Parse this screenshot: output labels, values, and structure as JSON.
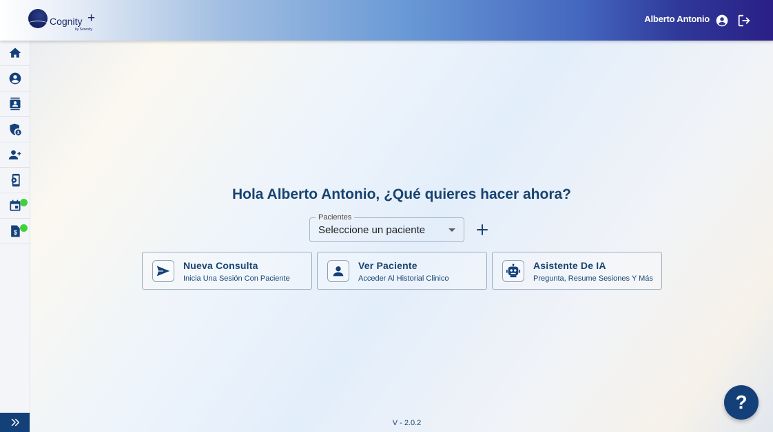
{
  "app": {
    "logo_text": "Cognity",
    "logo_plus": "+",
    "logo_sub": "by Serenity"
  },
  "header": {
    "user_name": "Alberto Antonio",
    "user_icon": "account-circle-icon",
    "logout_icon": "logout-icon"
  },
  "sidebar": {
    "items": [
      {
        "icon": "home-icon"
      },
      {
        "icon": "account-circle-icon"
      },
      {
        "icon": "contacts-icon"
      },
      {
        "icon": "shield-user-icon"
      },
      {
        "icon": "person-add-icon"
      },
      {
        "icon": "phone-settings-icon"
      },
      {
        "icon": "calendar-icon",
        "badge_color": "#3fd13c"
      },
      {
        "icon": "invoice-dollar-icon",
        "badge_color": "#3fd13c"
      }
    ],
    "expand_icon": "double-chevron-right-icon"
  },
  "main": {
    "greeting": "Hola Alberto Antonio, ¿Qué quieres hacer ahora?",
    "patient_select": {
      "label": "Pacientes",
      "value": "Seleccione un paciente"
    },
    "add_icon": "plus-icon",
    "cards": [
      {
        "title": "Nueva Consulta",
        "subtitle": "Inicia Una Sesión Con Paciente",
        "icon": "send-icon"
      },
      {
        "title": "Ver Paciente",
        "subtitle": "Acceder Al Historial Clinico",
        "icon": "person-icon"
      },
      {
        "title": "Asistente De IA",
        "subtitle": "Pregunta, Resume Sesiones Y Más",
        "icon": "robot-icon"
      }
    ]
  },
  "footer": {
    "version": "V - 2.0.2",
    "help_label": "?"
  },
  "colors": {
    "primary": "#14407a",
    "heading": "#18436f",
    "badge": "#3fd13c"
  }
}
